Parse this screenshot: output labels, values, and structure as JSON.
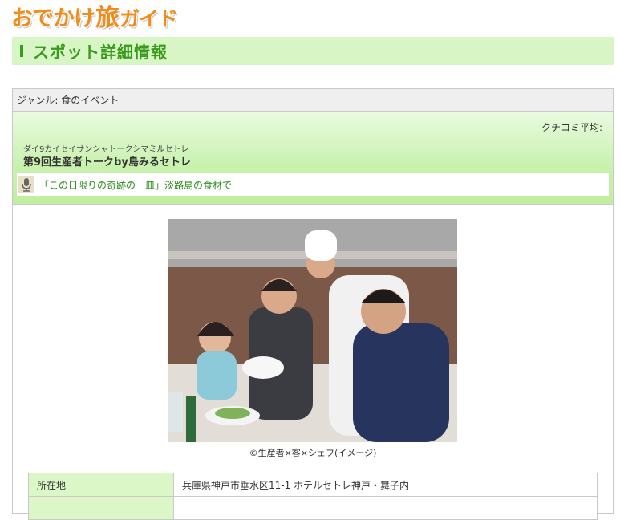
{
  "logo": {
    "part1": "おでかけ",
    "part2": "旅",
    "part3": "ガイド"
  },
  "page_title": "スポット詳細情報",
  "genre": "ジャンル: 食のイベント",
  "kuchikomi_label": "クチコミ平均:",
  "spot": {
    "kana": "ダイ9カイセイサンシャトークシマミルセトレ",
    "name": "第9回生産者トークby島みるセトレ",
    "catch": "「この日限りの奇跡の一皿」淡路島の食材で"
  },
  "photo": {
    "caption": "©生産者×客×シェフ(イメージ)"
  },
  "info": {
    "rows": [
      {
        "label": "所在地",
        "value": "兵庫県神戸市垂水区11-1 ホテルセトレ神戸・舞子内"
      },
      {
        "label": "",
        "value": ""
      }
    ]
  },
  "colors": {
    "accent_green": "#3a9a1c",
    "title_bg": "#d7f5c5",
    "logo_orange": "#f08c1a"
  }
}
